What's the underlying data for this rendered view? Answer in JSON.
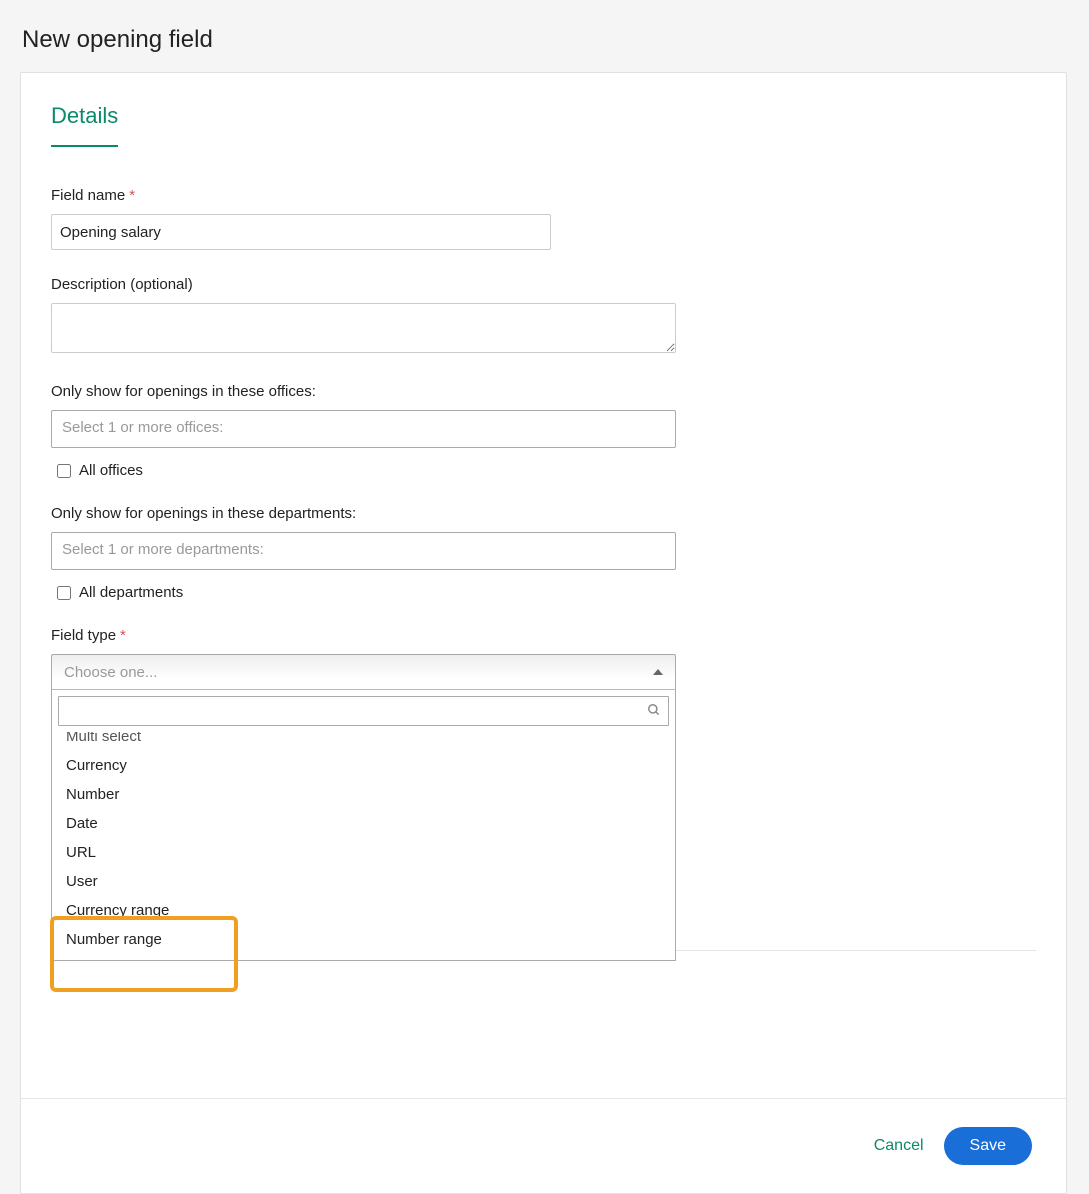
{
  "page_title": "New opening field",
  "tab_label": "Details",
  "field_name": {
    "label": "Field name",
    "value": "Opening salary"
  },
  "description": {
    "label": "Description (optional)",
    "value": ""
  },
  "offices": {
    "label": "Only show for openings in these offices:",
    "placeholder": "Select 1 or more offices:",
    "checkbox_label": "All offices"
  },
  "departments": {
    "label": "Only show for openings in these departments:",
    "placeholder": "Select 1 or more departments:",
    "checkbox_label": "All departments"
  },
  "field_type": {
    "label": "Field type",
    "placeholder": "Choose one...",
    "search_value": "",
    "options": [
      "Multi select",
      "Currency",
      "Number",
      "Date",
      "URL",
      "User",
      "Currency range",
      "Number range"
    ]
  },
  "footer": {
    "cancel": "Cancel",
    "save": "Save"
  }
}
